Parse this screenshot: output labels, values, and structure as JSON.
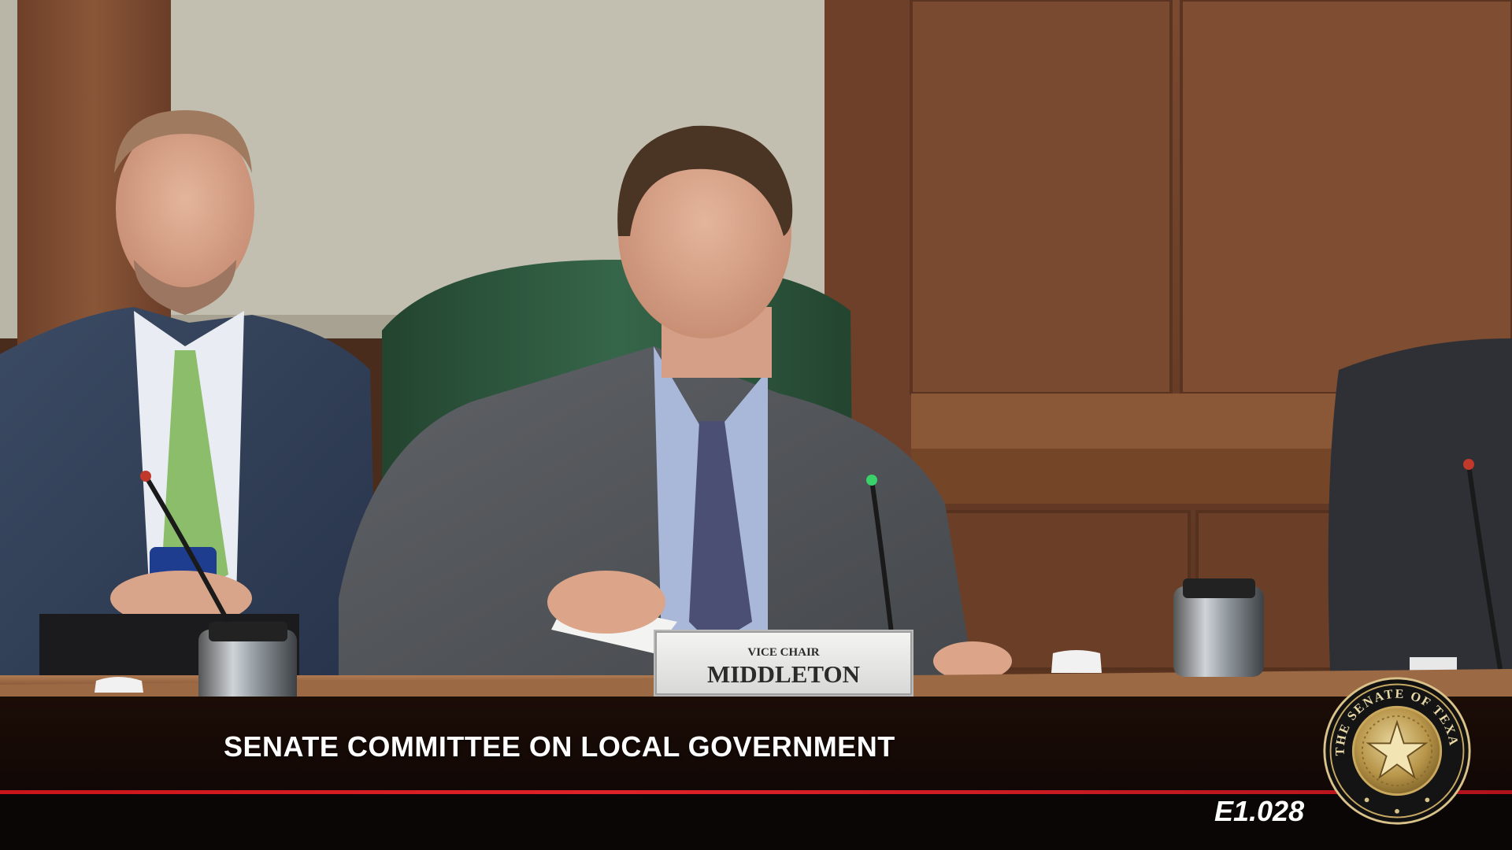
{
  "nameplate": {
    "role": "VICE CHAIR",
    "name": "MIDDLETON"
  },
  "banner": {
    "title": "SENATE COMMITTEE ON LOCAL GOVERNMENT",
    "room": "E1.028"
  },
  "seal": {
    "text": "THE SENATE OF TEXAS"
  },
  "colors": {
    "banner_red": "#d41c22",
    "seal_gold": "#b8964a",
    "wood": "#8a5a3c",
    "chair_green": "#2f5a40"
  }
}
